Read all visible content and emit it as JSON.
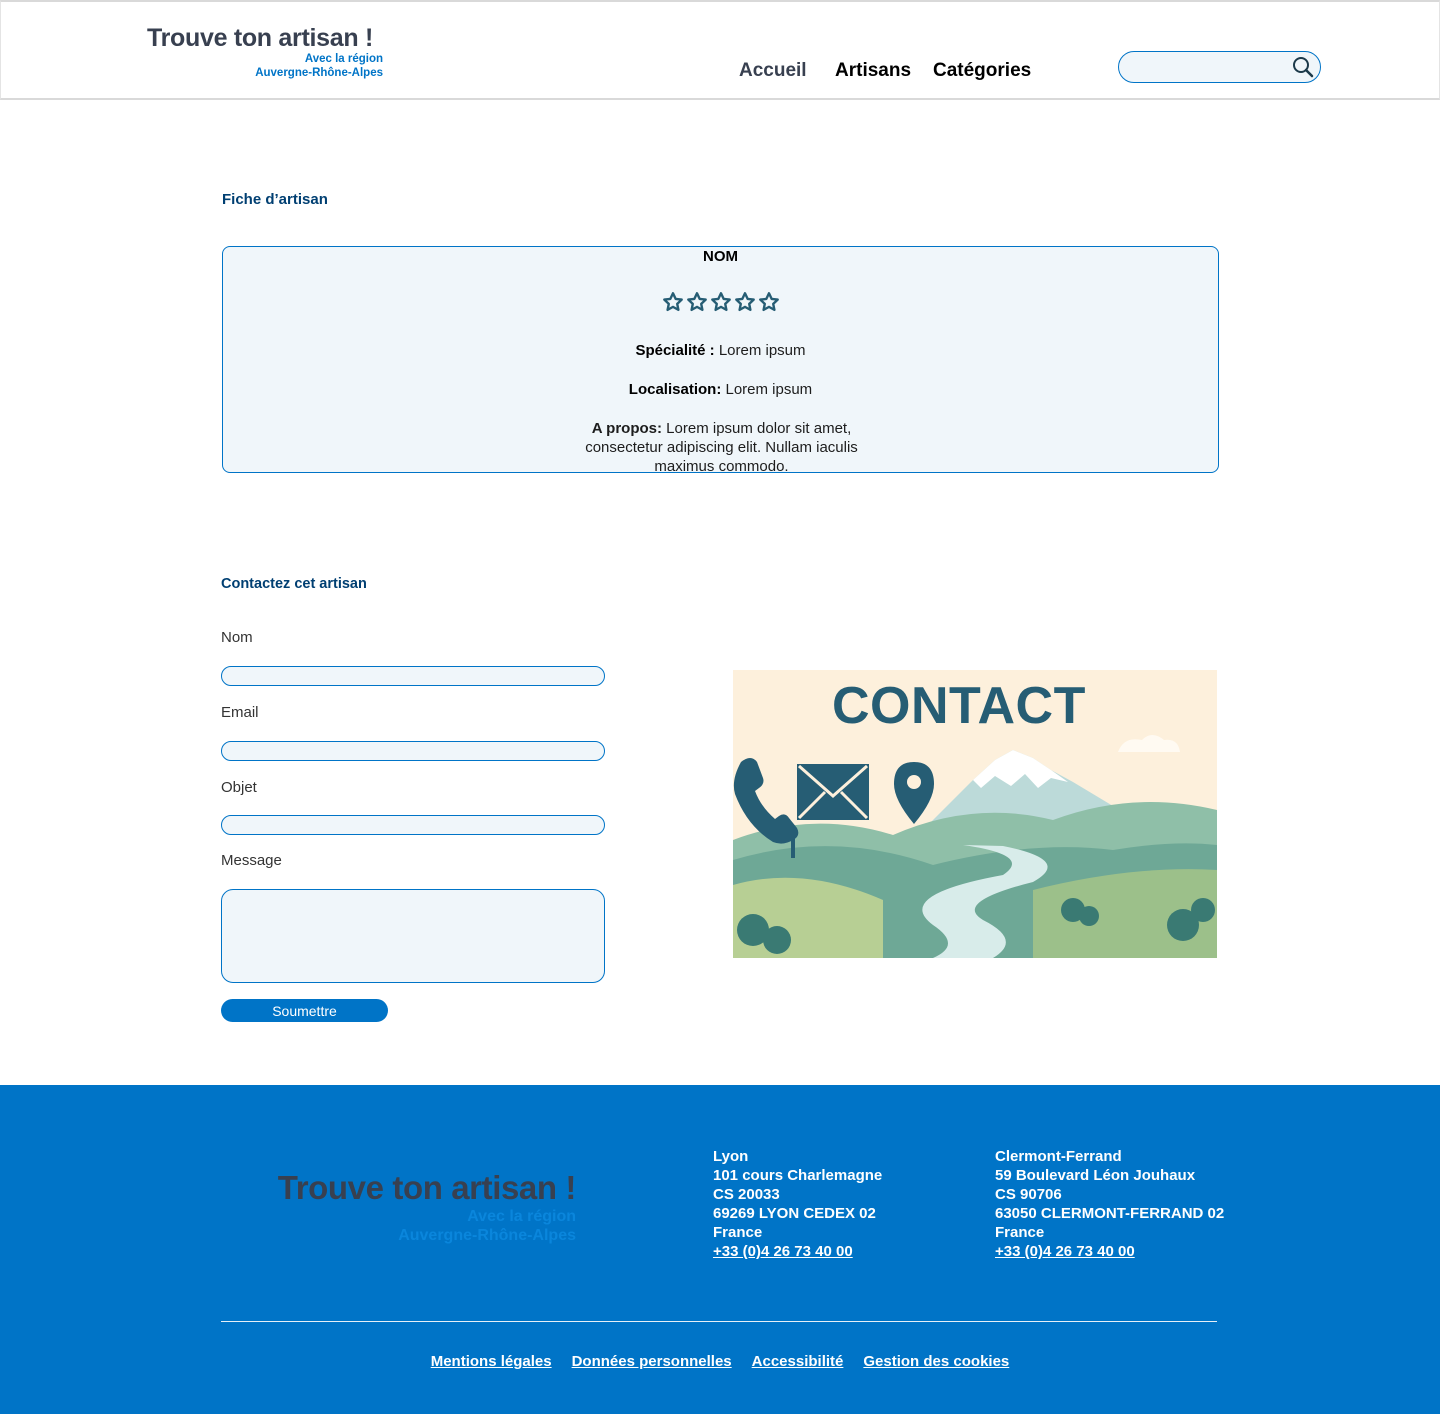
{
  "header": {
    "logo": {
      "line1": "Trouve ton artisan !",
      "line2": "Avec la région",
      "line3": "Auvergne-Rhône-Alpes"
    },
    "nav": [
      "Accueil",
      "Artisans",
      "Catégories"
    ],
    "search": {
      "placeholder": "",
      "icon": "search-icon"
    }
  },
  "fiche": {
    "section_title": "Fiche d’artisan",
    "nom": "NOM",
    "rating": {
      "stars": 5,
      "value": 0,
      "icon": "star-outline-icon",
      "color": "#265d74"
    },
    "specialite_label": "Spécialité :",
    "specialite_value": " Lorem ipsum",
    "localisation_label": "Localisation:",
    "localisation_value": " Lorem ipsum",
    "apropos_label": "A propos:",
    "apropos_value": " Lorem ipsum dolor sit amet, consectetur adipiscing elit. Nullam iaculis maximus commodo."
  },
  "contact": {
    "section_title": "Contactez cet artisan",
    "fields": [
      "Nom",
      "Email",
      "Objet",
      "Message"
    ],
    "submit_label": "Soumettre",
    "image": {
      "title": "CONTACT",
      "icons": [
        "phone-icon",
        "envelope-icon",
        "map-pin-icon"
      ]
    }
  },
  "footer": {
    "logo": {
      "line1": "Trouve ton artisan !",
      "line2": "Avec la région",
      "line3": "Auvergne-Rhône-Alpes"
    },
    "addresses": [
      {
        "city": "Lyon",
        "street": "101 cours Charlemagne",
        "cs": "CS 20033",
        "postal": "69269 LYON CEDEX 02",
        "country": "France",
        "phone": "+33 (0)4 26 73 40 00"
      },
      {
        "city": "Clermont-Ferrand",
        "street": "59 Boulevard Léon Jouhaux",
        "cs": "CS 90706",
        "postal": "63050 CLERMONT-FERRAND 02",
        "country": "France",
        "phone": "+33 (0)4 26 73 40 00"
      }
    ],
    "links": [
      "Mentions légales",
      "Données personnelles",
      "Accessibilité",
      "Gestion des cookies"
    ]
  },
  "colors": {
    "primary": "#0074c7",
    "dark_title": "#003f72",
    "logo_text": "#384050",
    "field_bg": "#f0f6fa"
  }
}
